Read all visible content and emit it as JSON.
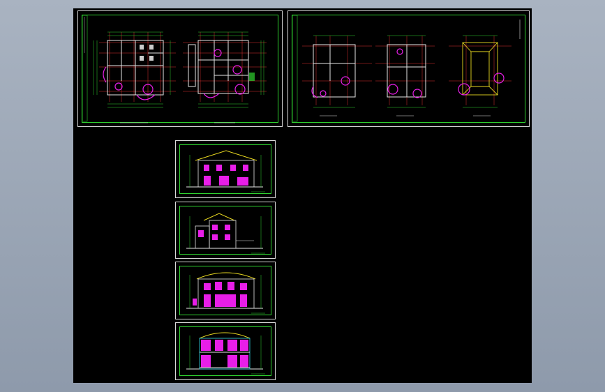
{
  "colors": {
    "background": "#000000",
    "frame": "#d8d8d8",
    "line_green": "#2fd32f",
    "line_white": "#e6e6e6",
    "line_red": "#e03030",
    "fill_magenta": "#e81ee8",
    "line_yellow": "#e8d820",
    "line_cyan": "#30d8e8",
    "desktop": "#a0abbb"
  },
  "sheets": [
    {
      "id": "floor-plans-1-2"
    },
    {
      "id": "floor-plans-3-roof"
    },
    {
      "id": "elevation-south"
    },
    {
      "id": "elevation-east"
    },
    {
      "id": "elevation-north"
    },
    {
      "id": "section-1-1"
    }
  ]
}
